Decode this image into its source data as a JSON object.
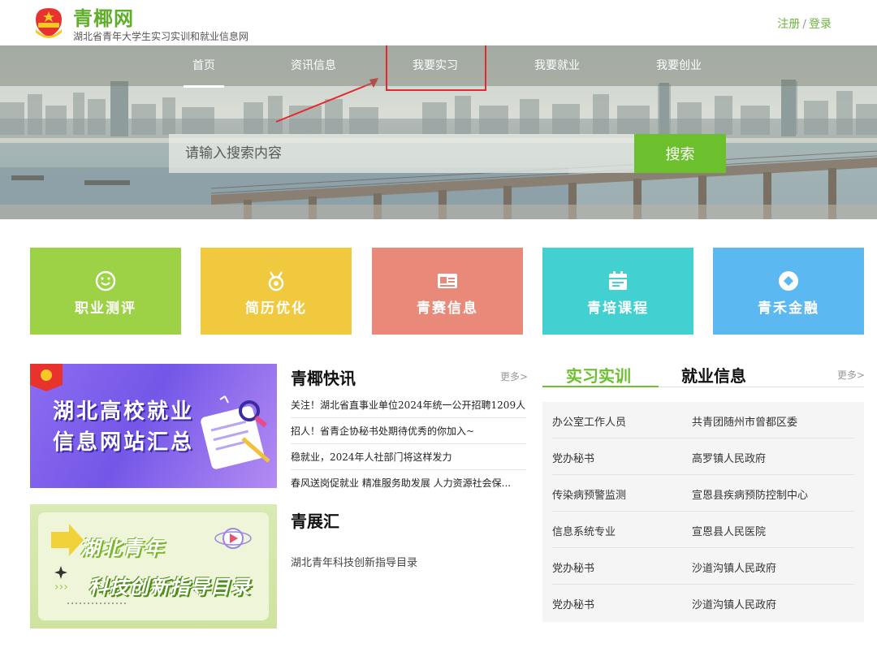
{
  "header": {
    "site_name": "青椰网",
    "site_subtitle": "湖北省青年大学生实习实训和就业信息网",
    "register": "注册",
    "separator": "/",
    "login": "登录"
  },
  "nav": {
    "items": [
      {
        "label": "首页",
        "active": true
      },
      {
        "label": "资讯信息",
        "active": false
      },
      {
        "label": "我要实习",
        "active": false
      },
      {
        "label": "我要就业",
        "active": false
      },
      {
        "label": "我要创业",
        "active": false
      }
    ]
  },
  "search": {
    "placeholder": "请输入搜索内容",
    "button_label": "搜索"
  },
  "tiles": [
    {
      "label": "职业测评",
      "color": "#9dd246",
      "icon": "smiley-icon"
    },
    {
      "label": "简历优化",
      "color": "#f0c93e",
      "icon": "medal-icon"
    },
    {
      "label": "青赛信息",
      "color": "#e8897a",
      "icon": "id-card-icon"
    },
    {
      "label": "青培课程",
      "color": "#43d0d0",
      "icon": "calendar-icon"
    },
    {
      "label": "青禾金融",
      "color": "#5bb8f0",
      "icon": "diamond-icon"
    }
  ],
  "promos": {
    "first": {
      "line1": "湖北高校就业",
      "line2": "信息网站汇总"
    },
    "second": {
      "line1": "湖北青年",
      "line2": "科技创新指导目录"
    }
  },
  "news": {
    "title": "青椰快讯",
    "more": "更多>",
    "items": [
      "关注！湖北省直事业单位2024年统一公开招聘1209人",
      "招人！省青企协秘书处期待优秀的你加入~",
      "稳就业，2024年人社部门将这样发力",
      "春风送岗促就业 精准服务助发展 人力资源社会保..."
    ]
  },
  "expo": {
    "title": "青展汇",
    "item": "湖北青年科技创新指导目录"
  },
  "jobs": {
    "tab_active": "实习实训",
    "tab_other": "就业信息",
    "more": "更多>",
    "rows": [
      {
        "title": "办公室工作人员",
        "org": "共青团随州市曾都区委"
      },
      {
        "title": "党办秘书",
        "org": "高罗镇人民政府"
      },
      {
        "title": "传染病预警监测",
        "org": "宣恩县疾病预防控制中心"
      },
      {
        "title": "信息系统专业",
        "org": "宣恩县人民医院"
      },
      {
        "title": "党办秘书",
        "org": "沙道沟镇人民政府"
      },
      {
        "title": "党办秘书",
        "org": "沙道沟镇人民政府"
      }
    ]
  },
  "colors": {
    "brand_green": "#6cbf2d",
    "annotation_red": "#e8262d"
  }
}
